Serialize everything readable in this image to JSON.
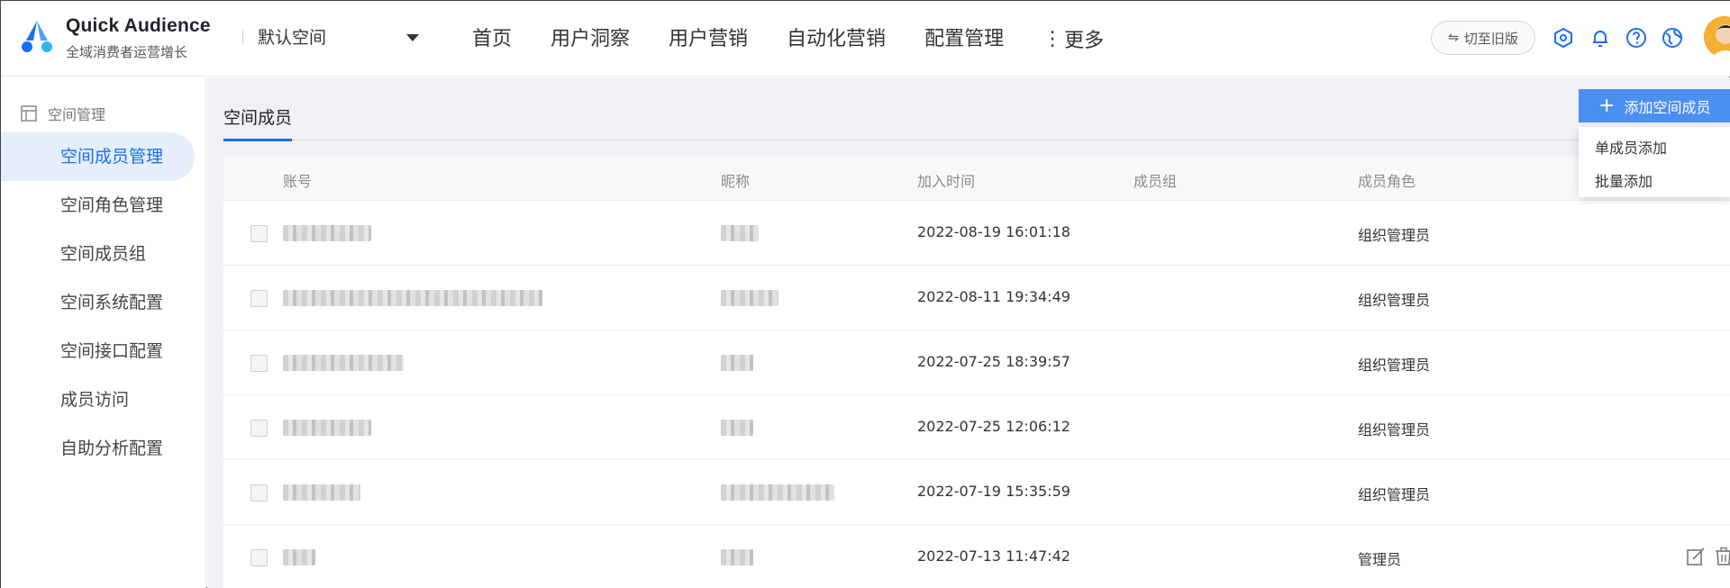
{
  "brand": {
    "title": "Quick Audience",
    "subtitle": "全域消费者运营增长",
    "logo_icon": "quick-audience-logo",
    "accent": "#1a6ef0"
  },
  "header": {
    "space_select": {
      "value": "默认空间",
      "caret_icon": "caret-down-icon"
    },
    "nav": [
      "首页",
      "用户洞察",
      "用户营销",
      "自动化营销",
      "配置管理"
    ],
    "more_dots": "⋮",
    "more_label": "更多",
    "switch_label": "切至旧版",
    "icons": [
      "settings-hex-icon",
      "bell-icon",
      "help-icon",
      "globe-icon"
    ]
  },
  "sidebar": {
    "section": "空间管理",
    "section_icon": "layout-icon",
    "items": [
      "空间成员管理",
      "空间角色管理",
      "空间成员组",
      "空间系统配置",
      "空间接口配置",
      "成员访问",
      "自助分析配置"
    ],
    "active": "空间成员管理"
  },
  "tabs": {
    "active": "空间成员"
  },
  "table": {
    "columns": [
      "账号",
      "昵称",
      "加入时间",
      "成员组",
      "成员角色"
    ],
    "rows": [
      {
        "time": "2022-08-19 16:01:18",
        "role": "组织管理员"
      },
      {
        "time": "2022-08-11 19:34:49",
        "role": "组织管理员"
      },
      {
        "time": "2022-07-25 18:39:57",
        "role": "组织管理员"
      },
      {
        "time": "2022-07-25 12:06:12",
        "role": "组织管理员"
      },
      {
        "time": "2022-07-19 15:35:59",
        "role": "组织管理员"
      },
      {
        "time": "2022-07-13 11:47:42",
        "role": "管理员"
      }
    ],
    "row_action_icons": [
      "edit-icon",
      "delete-icon"
    ]
  },
  "add_member": {
    "label": "添加空间成员",
    "plus": "+",
    "color": "#4b8ff1",
    "menu": [
      "单成员添加",
      "批量添加"
    ]
  }
}
